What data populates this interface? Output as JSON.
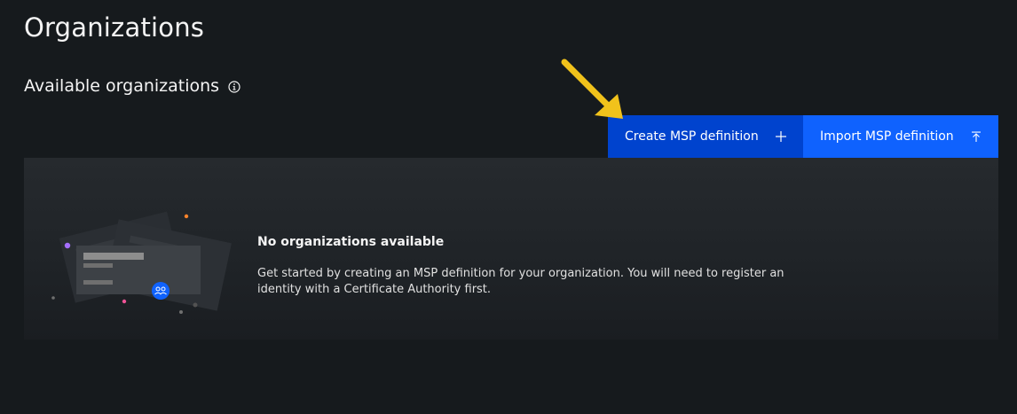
{
  "page": {
    "title": "Organizations"
  },
  "section": {
    "title": "Available organizations",
    "info_icon": "info-icon"
  },
  "actions": {
    "create_label": "Create MSP definition",
    "create_icon": "plus-icon",
    "import_label": "Import MSP definition",
    "import_icon": "upload-icon"
  },
  "empty_state": {
    "title": "No organizations available",
    "description": "Get started by creating an MSP definition for your organization. You will need to register an identity with a Certificate Authority first."
  },
  "colors": {
    "background": "#161a1d",
    "panel": "#262a2e",
    "create_button": "#0043ce",
    "import_button": "#0f62fe",
    "annotation_arrow": "#f1c21b"
  }
}
